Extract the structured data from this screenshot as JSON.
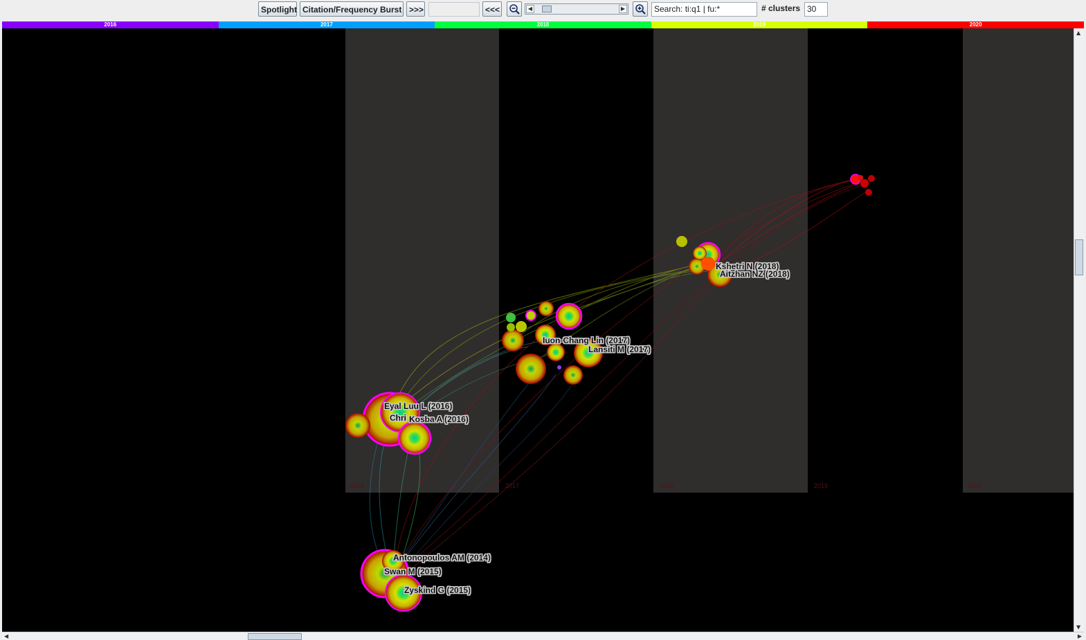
{
  "toolbar": {
    "spotlight_label": "Spotlight",
    "burst_label": "Citation/Frequency Burst",
    "forward_label": ">>>",
    "back_label": "<<<",
    "empty_field_value": "",
    "search_value": "Search: ti:q1 | fu:*",
    "clusters_label": "# clusters",
    "clusters_value": "30",
    "zoom_out_icon": "zoom-out-icon",
    "zoom_in_icon": "zoom-in-icon"
  },
  "timeline": {
    "years": [
      {
        "label": "2016",
        "color": "#8a00ff"
      },
      {
        "label": "2017",
        "color": "#00a0ff"
      },
      {
        "label": "2018",
        "color": "#00ff40"
      },
      {
        "label": "2019",
        "color": "#d8ff00"
      },
      {
        "label": "2020",
        "color": "#ff0000"
      }
    ],
    "column_labels": [
      "2016",
      "2017",
      "2018",
      "2019",
      "2020"
    ]
  },
  "nodes": [
    {
      "label": "Eyal Luu L (2016)"
    },
    {
      "label": "Chri"
    },
    {
      "label": "Kosba A (2016)"
    },
    {
      "label": "Iuon-Chang Lin (2017)"
    },
    {
      "label": "Lansiti M (2017)"
    },
    {
      "label": "Kshetri N (2018)"
    },
    {
      "label": "Aitzhan NZ (2018)"
    },
    {
      "label": "Antonopoulos AM (2014)"
    },
    {
      "label": "Swan M (2015)"
    },
    {
      "label": "Zyskind G (2015)"
    }
  ],
  "colors": {
    "canvas_bg": "#000000",
    "band_bg": "#302d2d",
    "accent_magenta": "#ff00ff",
    "node_red": "#c00000",
    "node_yellow": "#d8e000",
    "node_green": "#00c040"
  }
}
